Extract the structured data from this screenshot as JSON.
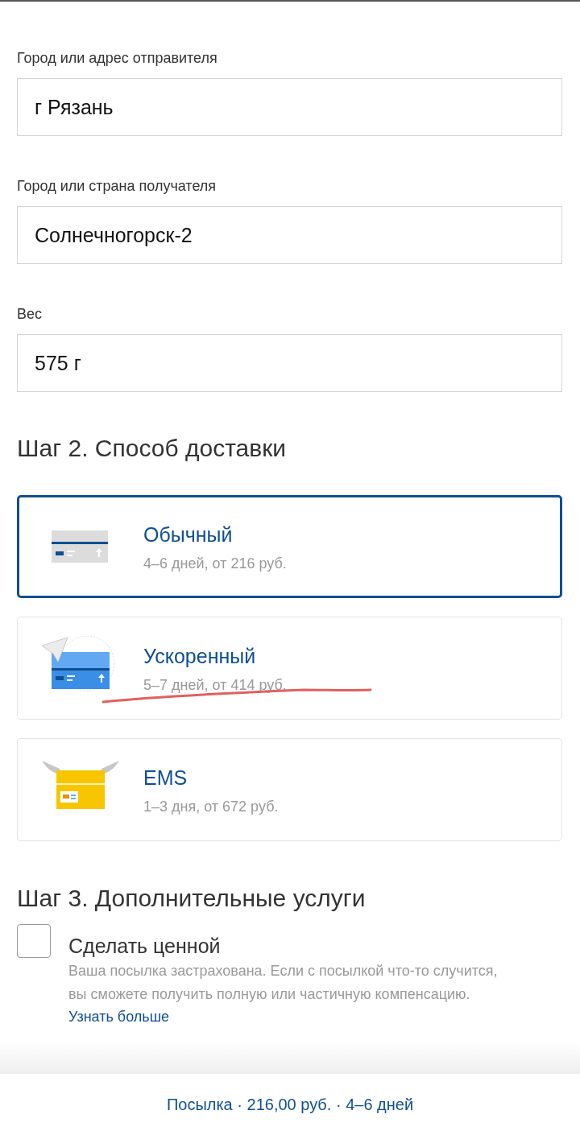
{
  "fields": [
    {
      "label": "Город или адрес отправителя",
      "value": "г Рязань"
    },
    {
      "label": "Город или страна получателя",
      "value": "Солнечногорск-2"
    },
    {
      "label": "Вес",
      "value": "575 г"
    }
  ],
  "delivery": {
    "heading": "Шаг 2. Способ доставки",
    "options": [
      {
        "kind": "standard",
        "title": "Обычный",
        "details": "4–6 дней, от 216 руб.",
        "selected": true
      },
      {
        "kind": "express",
        "title": "Ускоренный",
        "details": "5–7 дней, от 414 руб.",
        "selected": false
      },
      {
        "kind": "ems",
        "title": "EMS",
        "details": "1–3 дня, от 672 руб.",
        "selected": false
      }
    ]
  },
  "extras": {
    "heading": "Шаг 3. Дополнительные услуги",
    "options": [
      {
        "label": "Сделать ценной",
        "description": "Ваша посылка застрахована. Если с посылкой что-то случится, вы сможете получить полную или частичную компенсацию.",
        "link": "Узнать больше",
        "checked": false
      }
    ]
  },
  "summary": "Посылка · 216,00 руб. · 4–6 дней"
}
